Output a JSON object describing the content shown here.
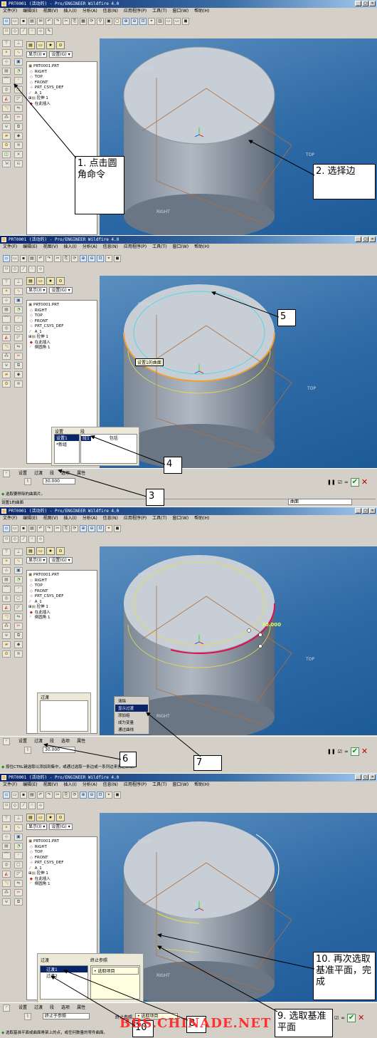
{
  "window_title": "PRT0001 (活动的) - Pro/ENGINEER Wildfire 4.0",
  "menus": [
    "文件(F)",
    "编辑(E)",
    "视图(V)",
    "插入(I)",
    "分析(A)",
    "信息(N)",
    "应用程序(P)",
    "工具(T)",
    "窗口(W)",
    "帮助(H)"
  ],
  "window_buttons": [
    "_",
    "□",
    "×"
  ],
  "tree_display_label": "显示(I) ▾",
  "tree_settings_label": "设置(G) ▾",
  "tree_p1": [
    "PRT0001.PRT",
    "RIGHT",
    "TOP",
    "FRONT",
    "PRT_CSYS_DEF",
    "A_1",
    "拉伸 1",
    "在此插入"
  ],
  "tree_p2": [
    "PRT0001.PRT",
    "RIGHT",
    "TOP",
    "FRONT",
    "PRT_CSYS_DEF",
    "A_1",
    "拉伸 1",
    "在此插入",
    "倒圆角 1"
  ],
  "view_labels": {
    "front": "FRONT",
    "top": "TOP",
    "right": "RIGHT"
  },
  "panel2": {
    "tooltip": "设置1的曲面",
    "set_header": "设置",
    "seg_header": "段",
    "set_item": "设置1",
    "set_new": "*新组",
    "seg_item": "段1",
    "seg_status": "包括",
    "dash_tabs": [
      "设置",
      "过渡",
      "段",
      "选项",
      "属性"
    ],
    "radius": "30.000",
    "prompt": "选取要移除的曲面片。",
    "status_line": "设置1的曲面",
    "filter": "曲面"
  },
  "panel3": {
    "dim_value": "30.000",
    "transition_header": "过渡",
    "context_menu": [
      "清除",
      "显示过渡",
      "添加组",
      "成为变量",
      "通过曲线"
    ],
    "context_selected": "显示过渡",
    "dash_tabs": [
      "设置",
      "过渡",
      "段",
      "选项",
      "属性"
    ],
    "radius": "30.000",
    "prompt": "按住CTRL键选取以添加到集中，或通过选取一条边或一系列边来创建新集。"
  },
  "panel4": {
    "transition_header": "过渡",
    "stop_ref_header": "终止参照",
    "trans_items": [
      "过渡1",
      "过渡2"
    ],
    "stop_item": "• 选取项目",
    "dash_tabs": [
      "设置",
      "过渡",
      "段",
      "选项",
      "属性"
    ],
    "combo_value": "终止于参照",
    "stop_ref_label": "终止参照",
    "stop_ref_value": "• 选取项目",
    "prompt": "选取基准平面或曲面骨架上的点，或任何数量的零件曲面。"
  },
  "callouts": {
    "c1": "1. 点击圆角命令",
    "c2": "2. 选择边",
    "c3": "3",
    "c4": "4",
    "c5": "5",
    "c6": "6",
    "c7": "7",
    "c8": "8",
    "c9": "9. 选取基准平面",
    "c10": "10",
    "c10b": "10. 再次选取基准平面，完成"
  },
  "watermark": "BBS.CHINADE.NET",
  "colors": {
    "viewport": "#2e6aa6",
    "selection_orange": "#f0a030",
    "highlight_red": "#e01050",
    "yellow_edge": "#f0f040"
  }
}
